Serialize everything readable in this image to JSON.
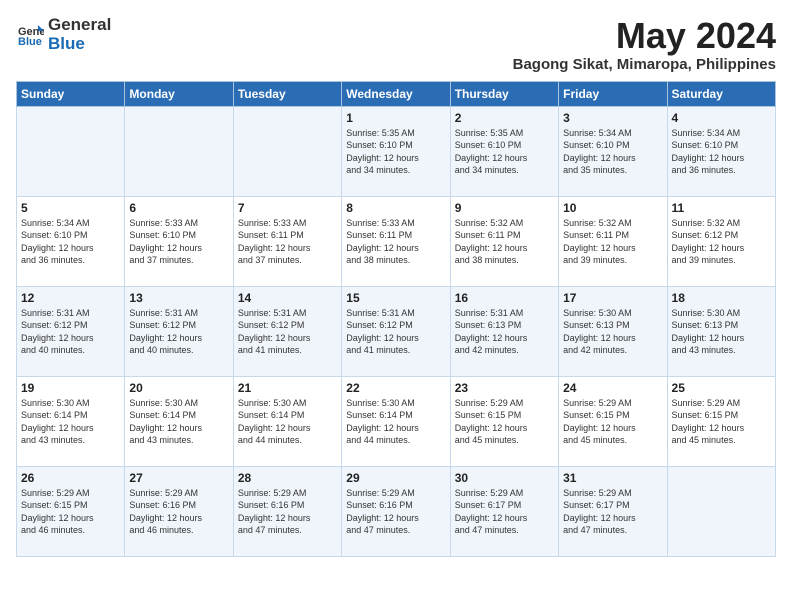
{
  "header": {
    "logo_general": "General",
    "logo_blue": "Blue",
    "title": "May 2024",
    "subtitle": "Bagong Sikat, Mimaropa, Philippines"
  },
  "weekdays": [
    "Sunday",
    "Monday",
    "Tuesday",
    "Wednesday",
    "Thursday",
    "Friday",
    "Saturday"
  ],
  "weeks": [
    [
      {
        "day": "",
        "info": ""
      },
      {
        "day": "",
        "info": ""
      },
      {
        "day": "",
        "info": ""
      },
      {
        "day": "1",
        "info": "Sunrise: 5:35 AM\nSunset: 6:10 PM\nDaylight: 12 hours\nand 34 minutes."
      },
      {
        "day": "2",
        "info": "Sunrise: 5:35 AM\nSunset: 6:10 PM\nDaylight: 12 hours\nand 34 minutes."
      },
      {
        "day": "3",
        "info": "Sunrise: 5:34 AM\nSunset: 6:10 PM\nDaylight: 12 hours\nand 35 minutes."
      },
      {
        "day": "4",
        "info": "Sunrise: 5:34 AM\nSunset: 6:10 PM\nDaylight: 12 hours\nand 36 minutes."
      }
    ],
    [
      {
        "day": "5",
        "info": "Sunrise: 5:34 AM\nSunset: 6:10 PM\nDaylight: 12 hours\nand 36 minutes."
      },
      {
        "day": "6",
        "info": "Sunrise: 5:33 AM\nSunset: 6:10 PM\nDaylight: 12 hours\nand 37 minutes."
      },
      {
        "day": "7",
        "info": "Sunrise: 5:33 AM\nSunset: 6:11 PM\nDaylight: 12 hours\nand 37 minutes."
      },
      {
        "day": "8",
        "info": "Sunrise: 5:33 AM\nSunset: 6:11 PM\nDaylight: 12 hours\nand 38 minutes."
      },
      {
        "day": "9",
        "info": "Sunrise: 5:32 AM\nSunset: 6:11 PM\nDaylight: 12 hours\nand 38 minutes."
      },
      {
        "day": "10",
        "info": "Sunrise: 5:32 AM\nSunset: 6:11 PM\nDaylight: 12 hours\nand 39 minutes."
      },
      {
        "day": "11",
        "info": "Sunrise: 5:32 AM\nSunset: 6:12 PM\nDaylight: 12 hours\nand 39 minutes."
      }
    ],
    [
      {
        "day": "12",
        "info": "Sunrise: 5:31 AM\nSunset: 6:12 PM\nDaylight: 12 hours\nand 40 minutes."
      },
      {
        "day": "13",
        "info": "Sunrise: 5:31 AM\nSunset: 6:12 PM\nDaylight: 12 hours\nand 40 minutes."
      },
      {
        "day": "14",
        "info": "Sunrise: 5:31 AM\nSunset: 6:12 PM\nDaylight: 12 hours\nand 41 minutes."
      },
      {
        "day": "15",
        "info": "Sunrise: 5:31 AM\nSunset: 6:12 PM\nDaylight: 12 hours\nand 41 minutes."
      },
      {
        "day": "16",
        "info": "Sunrise: 5:31 AM\nSunset: 6:13 PM\nDaylight: 12 hours\nand 42 minutes."
      },
      {
        "day": "17",
        "info": "Sunrise: 5:30 AM\nSunset: 6:13 PM\nDaylight: 12 hours\nand 42 minutes."
      },
      {
        "day": "18",
        "info": "Sunrise: 5:30 AM\nSunset: 6:13 PM\nDaylight: 12 hours\nand 43 minutes."
      }
    ],
    [
      {
        "day": "19",
        "info": "Sunrise: 5:30 AM\nSunset: 6:14 PM\nDaylight: 12 hours\nand 43 minutes."
      },
      {
        "day": "20",
        "info": "Sunrise: 5:30 AM\nSunset: 6:14 PM\nDaylight: 12 hours\nand 43 minutes."
      },
      {
        "day": "21",
        "info": "Sunrise: 5:30 AM\nSunset: 6:14 PM\nDaylight: 12 hours\nand 44 minutes."
      },
      {
        "day": "22",
        "info": "Sunrise: 5:30 AM\nSunset: 6:14 PM\nDaylight: 12 hours\nand 44 minutes."
      },
      {
        "day": "23",
        "info": "Sunrise: 5:29 AM\nSunset: 6:15 PM\nDaylight: 12 hours\nand 45 minutes."
      },
      {
        "day": "24",
        "info": "Sunrise: 5:29 AM\nSunset: 6:15 PM\nDaylight: 12 hours\nand 45 minutes."
      },
      {
        "day": "25",
        "info": "Sunrise: 5:29 AM\nSunset: 6:15 PM\nDaylight: 12 hours\nand 45 minutes."
      }
    ],
    [
      {
        "day": "26",
        "info": "Sunrise: 5:29 AM\nSunset: 6:15 PM\nDaylight: 12 hours\nand 46 minutes."
      },
      {
        "day": "27",
        "info": "Sunrise: 5:29 AM\nSunset: 6:16 PM\nDaylight: 12 hours\nand 46 minutes."
      },
      {
        "day": "28",
        "info": "Sunrise: 5:29 AM\nSunset: 6:16 PM\nDaylight: 12 hours\nand 47 minutes."
      },
      {
        "day": "29",
        "info": "Sunrise: 5:29 AM\nSunset: 6:16 PM\nDaylight: 12 hours\nand 47 minutes."
      },
      {
        "day": "30",
        "info": "Sunrise: 5:29 AM\nSunset: 6:17 PM\nDaylight: 12 hours\nand 47 minutes."
      },
      {
        "day": "31",
        "info": "Sunrise: 5:29 AM\nSunset: 6:17 PM\nDaylight: 12 hours\nand 47 minutes."
      },
      {
        "day": "",
        "info": ""
      }
    ]
  ]
}
